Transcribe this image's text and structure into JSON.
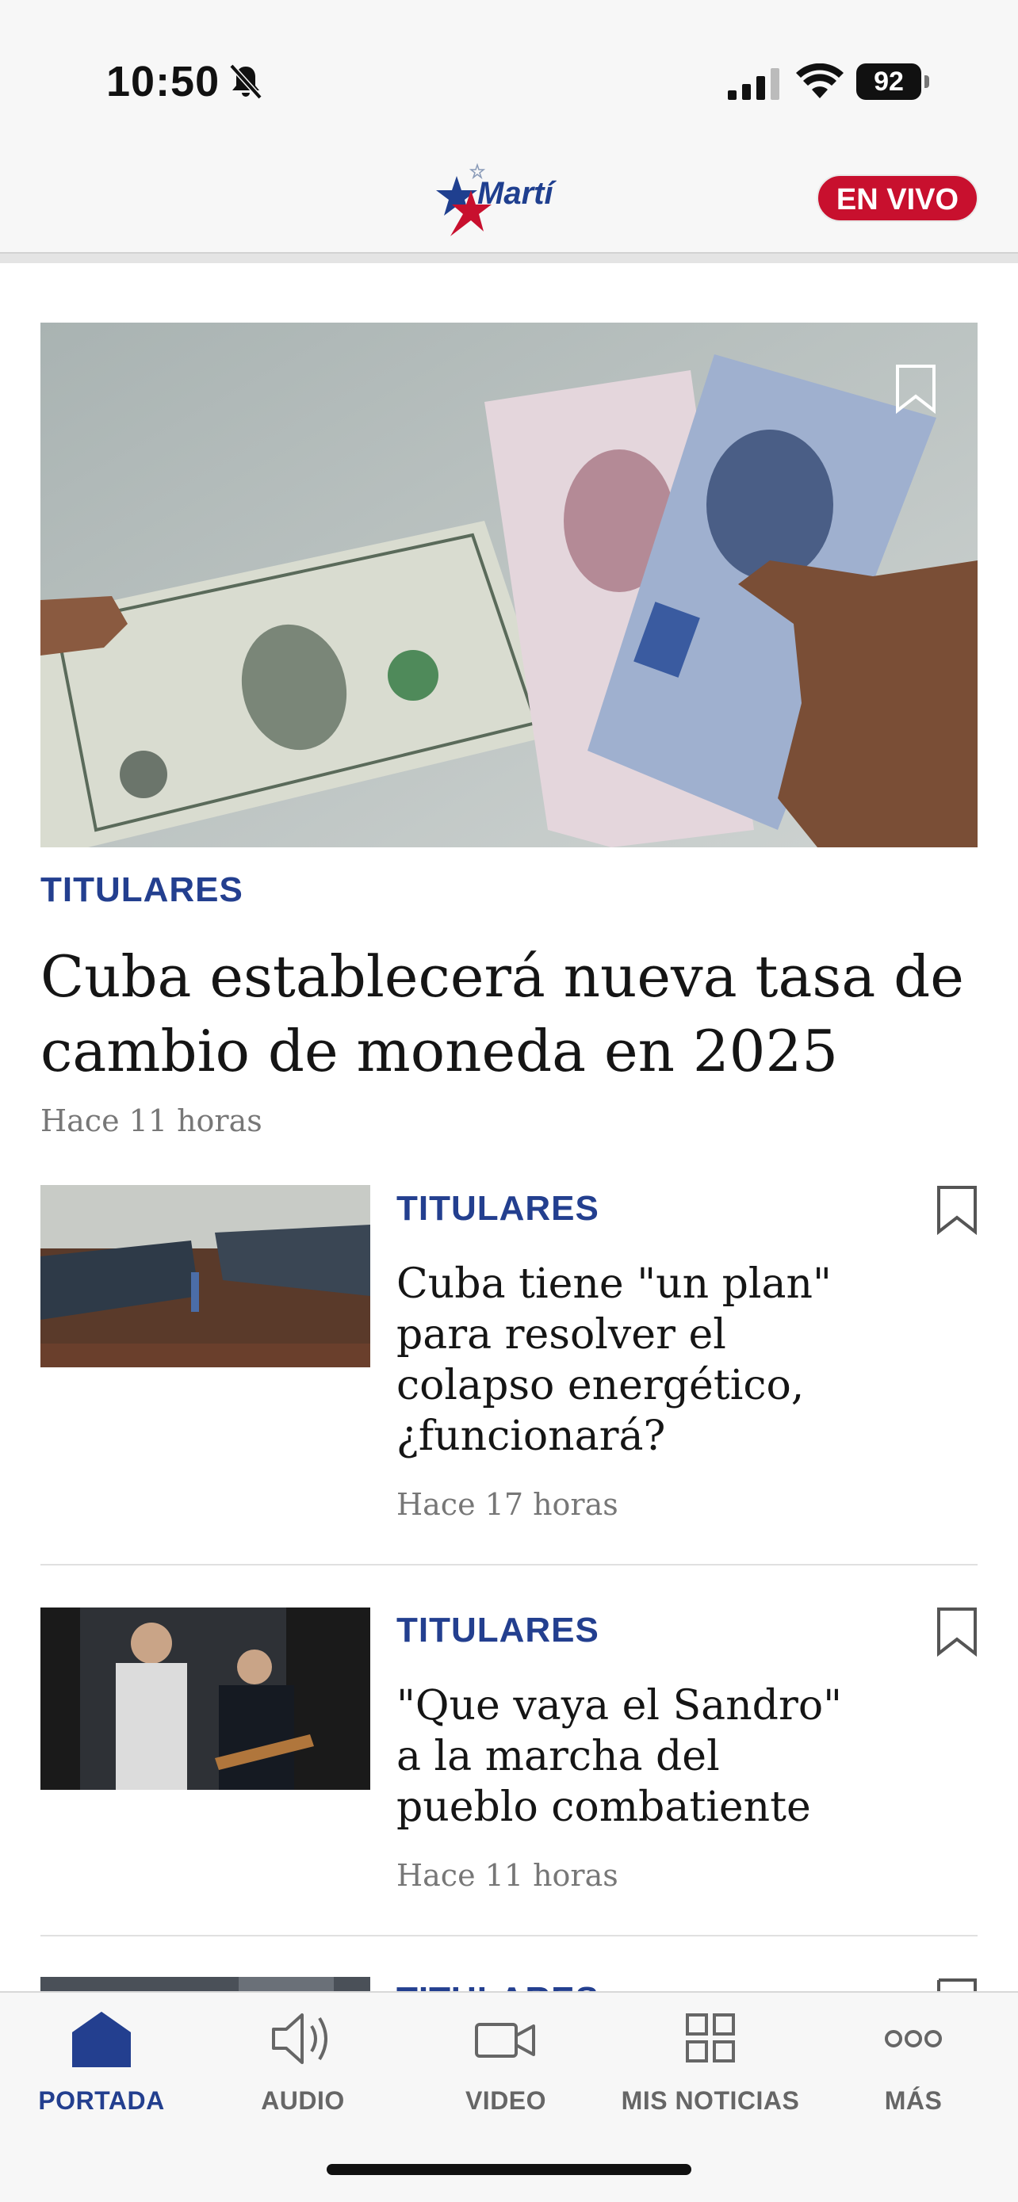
{
  "status_bar": {
    "time": "10:50",
    "battery": "92"
  },
  "header": {
    "logo_text": "Martí",
    "live_label": "EN VIVO"
  },
  "hero": {
    "category": "TITULARES",
    "title": "Cuba establecerá nueva tasa de cambio de moneda en 2025",
    "time": "Hace 11 horas"
  },
  "articles": [
    {
      "category": "TITULARES",
      "title": "Cuba tiene \"un plan\" para resolver el colapso energético, ¿funcionará?",
      "time": "Hace 17 horas"
    },
    {
      "category": "TITULARES",
      "title": "\"Que vaya el Sandro\" a la marcha del pueblo combatiente",
      "time": "Hace 11 horas"
    },
    {
      "category": "TITULARES"
    }
  ],
  "tab_bar": {
    "tabs": [
      {
        "label": "PORTADA",
        "icon": "home-icon",
        "active": true
      },
      {
        "label": "AUDIO",
        "icon": "speaker-icon",
        "active": false
      },
      {
        "label": "VIDEO",
        "icon": "video-camera-icon",
        "active": false
      },
      {
        "label": "MIS NOTICIAS",
        "icon": "grid-icon",
        "active": false
      },
      {
        "label": "MÁS",
        "icon": "more-dots-icon",
        "active": false
      }
    ]
  },
  "colors": {
    "brand_blue": "#233f8f",
    "live_red": "#c8102e"
  }
}
